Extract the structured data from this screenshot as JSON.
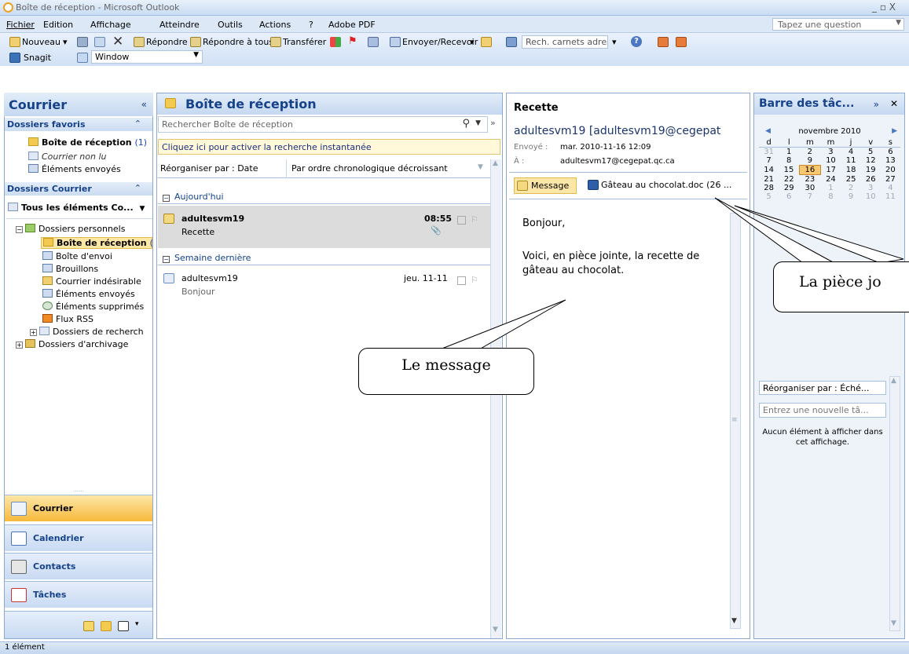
{
  "window": {
    "title": "Boîte de réception - Microsoft Outlook",
    "controls": "_ ▫ X"
  },
  "menu": {
    "items": [
      "Fichier",
      "Edition",
      "Affichage",
      "Atteindre",
      "Outils",
      "Actions",
      "?",
      "Adobe PDF"
    ],
    "help_placeholder": "Tapez une question"
  },
  "toolbar": {
    "new": "Nouveau",
    "reply": "Répondre",
    "reply_all": "Répondre à tous",
    "forward": "Transférer",
    "send_receive": "Envoyer/Recevoir",
    "address_search": "Rech. carnets adresses",
    "snagit": "Snagit",
    "window": "Window"
  },
  "nav": {
    "title": "Courrier",
    "favorites_header": "Dossiers favoris",
    "favorites": [
      {
        "label": "Boîte de réception",
        "count": "(1)"
      },
      {
        "label": "Courrier non lu"
      },
      {
        "label": "Éléments envoyés"
      }
    ],
    "mail_folders_header": "Dossiers Courrier",
    "all_items": "Tous les éléments Co...",
    "tree": [
      "Dossiers personnels",
      "Boîte de réception",
      "Boîte d'envoi",
      "Brouillons",
      "Courrier indésirable",
      "Éléments envoyés",
      "Éléments supprimés",
      "Flux RSS",
      "Dossiers de recherch",
      "Dossiers d'archivage"
    ],
    "tree_inbox_count": "(",
    "buttons": [
      "Courrier",
      "Calendrier",
      "Contacts",
      "Tâches"
    ]
  },
  "inbox": {
    "title": "Boîte de réception",
    "search_placeholder": "Rechercher Boîte de réception",
    "instant_search": "Cliquez ici pour activer la recherche instantanée",
    "arrange_by": "Réorganiser par : Date",
    "order": "Par ordre chronologique décroissant",
    "groups": [
      {
        "label": "Aujourd'hui",
        "items": [
          {
            "from": "adultesvm19",
            "subject": "Recette",
            "time": "08:55"
          }
        ]
      },
      {
        "label": "Semaine dernière",
        "items": [
          {
            "from": "adultesvm19",
            "subject": "Bonjour",
            "time": "jeu. 11-11"
          }
        ]
      }
    ]
  },
  "reading": {
    "subject": "Recette",
    "from": "adultesvm19 [adultesvm19@cegepat",
    "sent_label": "Envoyé :",
    "sent_value": "mar. 2010-11-16 12:09",
    "to_label": "À :",
    "to_value": "adultesvm17@cegepat.qc.ca",
    "tab_message": "Message",
    "attachment": "Gâteau au chocolat.doc (26 ...",
    "body": [
      "Bonjour,",
      "Voici, en pièce jointe, la recette de gâteau au chocolat."
    ]
  },
  "todo": {
    "title": "Barre des tâc...",
    "month": "novembre 2010",
    "weekdays": [
      "d",
      "l",
      "m",
      "m",
      "j",
      "v",
      "s"
    ],
    "weeks": [
      [
        "31",
        "1",
        "2",
        "3",
        "4",
        "5",
        "6"
      ],
      [
        "7",
        "8",
        "9",
        "10",
        "11",
        "12",
        "13"
      ],
      [
        "14",
        "15",
        "16",
        "17",
        "18",
        "19",
        "20"
      ],
      [
        "21",
        "22",
        "23",
        "24",
        "25",
        "26",
        "27"
      ],
      [
        "28",
        "29",
        "30",
        "1",
        "2",
        "3",
        "4"
      ],
      [
        "5",
        "6",
        "7",
        "8",
        "9",
        "10",
        "11"
      ]
    ],
    "today": "16",
    "arrange": "Réorganiser par : Éché...",
    "new_task_placeholder": "Entrez une nouvelle tâ...",
    "empty": "Aucun élément à afficher dans cet affichage."
  },
  "status": {
    "text": "1 élément"
  },
  "annotations": {
    "message": "Le message",
    "attachment": "La pièce jo"
  }
}
